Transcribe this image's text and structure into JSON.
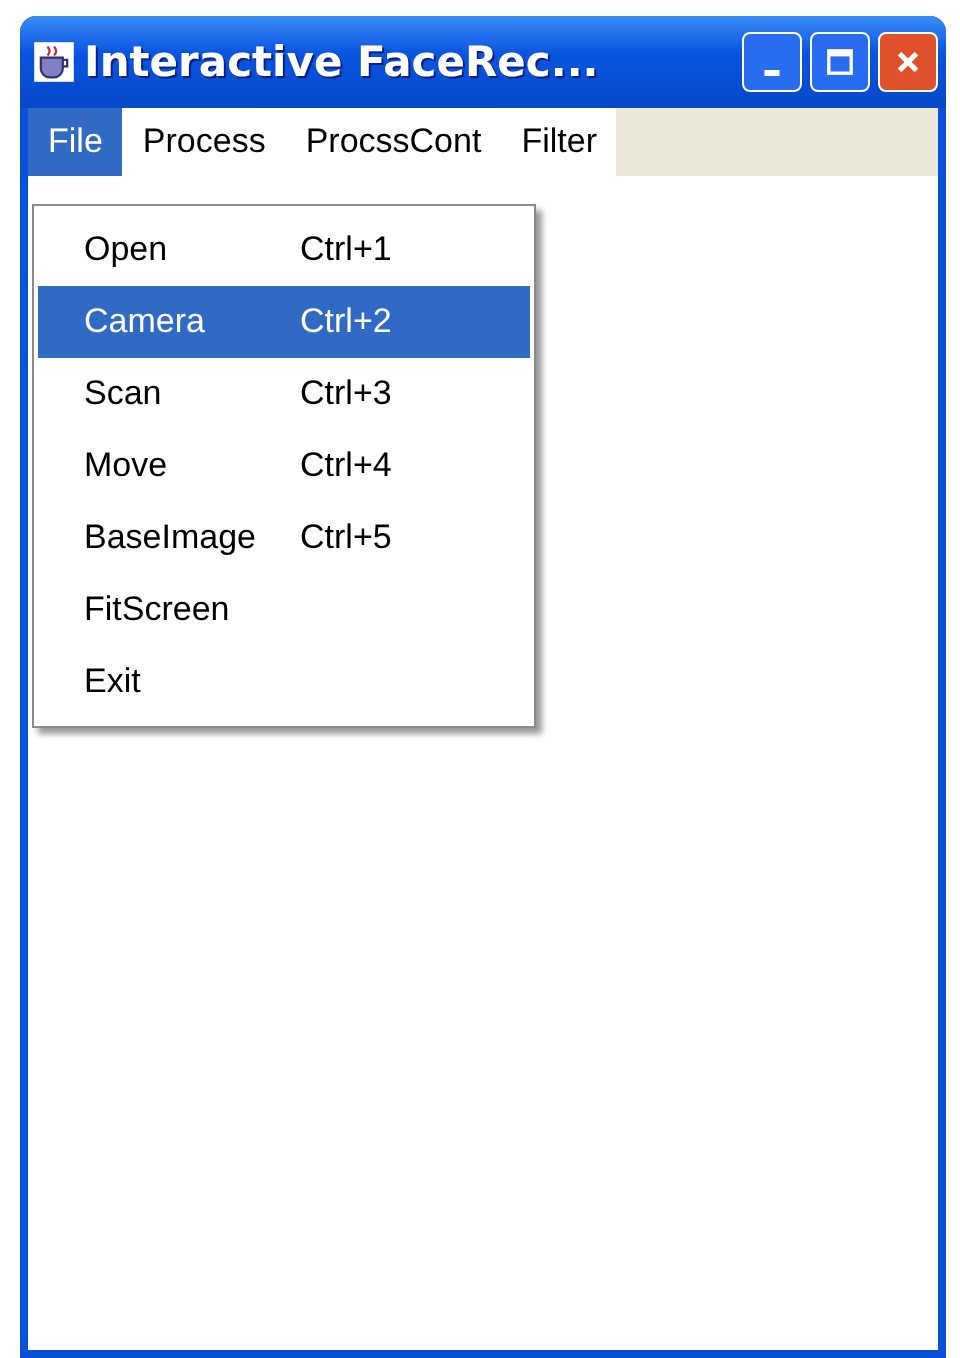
{
  "window": {
    "title": "Interactive FaceRec..."
  },
  "menubar": [
    {
      "label": "File",
      "selected": true
    },
    {
      "label": "Process",
      "selected": false
    },
    {
      "label": "ProcssCont",
      "selected": false
    },
    {
      "label": "Filter",
      "selected": false
    }
  ],
  "menu": [
    {
      "label": "Open",
      "shortcut": "Ctrl+1",
      "selected": false
    },
    {
      "label": "Camera",
      "shortcut": "Ctrl+2",
      "selected": true
    },
    {
      "label": "Scan",
      "shortcut": "Ctrl+3",
      "selected": false
    },
    {
      "label": "Move",
      "shortcut": "Ctrl+4",
      "selected": false
    },
    {
      "label": "BaseImage",
      "shortcut": "Ctrl+5",
      "selected": false
    },
    {
      "label": "FitScreen",
      "selected": false
    },
    {
      "label": "Exit",
      "selected": false
    }
  ]
}
